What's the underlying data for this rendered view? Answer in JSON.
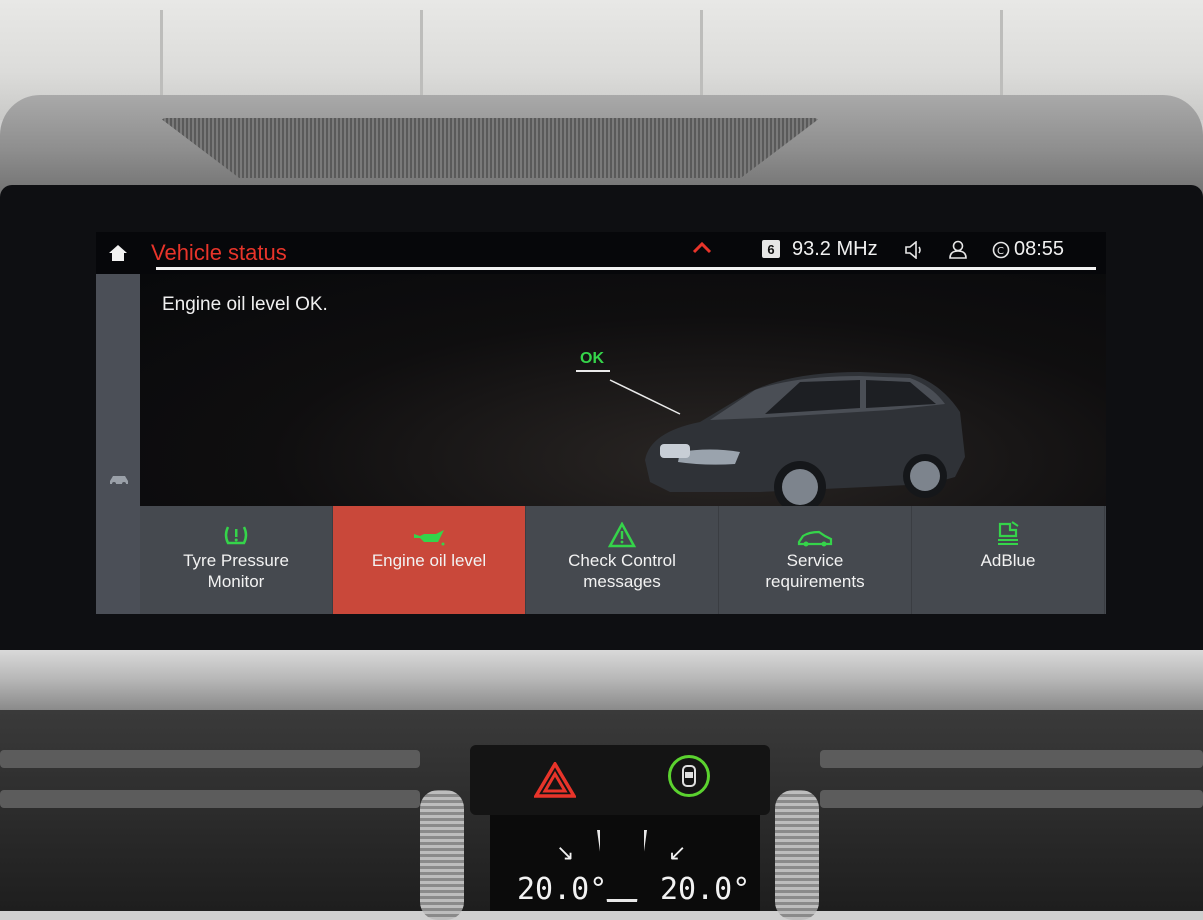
{
  "header": {
    "title": "Vehicle status",
    "radio_preset": "6",
    "radio_frequency": "93.2 MHz",
    "clock": "08:55"
  },
  "content": {
    "status_message": "Engine oil level OK.",
    "oil_indicator": "OK"
  },
  "tabs": [
    {
      "label": "Tyre Pressure\nMonitor",
      "icon": "tyre-pressure-icon",
      "active": false
    },
    {
      "label": "Engine oil level",
      "icon": "oil-can-icon",
      "active": true
    },
    {
      "label": "Check Control\nmessages",
      "icon": "warning-triangle-icon",
      "active": false
    },
    {
      "label": "Service\nrequirements",
      "icon": "car-service-icon",
      "active": false
    },
    {
      "label": "AdBlue",
      "icon": "adblue-icon",
      "active": false
    }
  ],
  "climate": {
    "left_temp": "20.0°",
    "right_temp": "20.0°"
  },
  "colors": {
    "accent_red": "#e8342a",
    "ok_green": "#35d44a",
    "active_tab": "#c9483a"
  }
}
